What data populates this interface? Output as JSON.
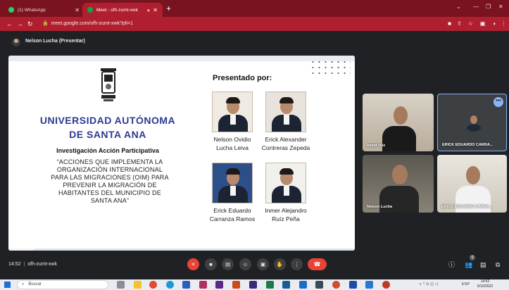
{
  "browser": {
    "tabs": [
      {
        "title": "(1) WhatsApp",
        "favicon_color": "#25d366",
        "active": false
      },
      {
        "title": "Meet - ofh-zumt-xwk",
        "favicon_color": "#00ac47",
        "active": true
      }
    ],
    "url": "meet.google.com/ofh-zumt-xwk?pli=1",
    "tab_color": "#7a1320",
    "toolbar_color": "#b01f2f"
  },
  "meet": {
    "presenter_label": "Nelson Lucha (Presentar)",
    "time": "14:52",
    "meeting_code": "ofh-zumt-xwk",
    "participant_count": "6",
    "participants": [
      {
        "name": "Inmer ruiz"
      },
      {
        "name": "ERICK EDUARDO CARRA..."
      },
      {
        "name": "Nelson Lucha"
      },
      {
        "name": "ERICK EDUARDO CARRA..."
      }
    ]
  },
  "slide": {
    "university": "UNIVERSIDAD AUTÓNOMA DE SANTA ANA",
    "university_line1": "UNIVERSIDAD AUTÓNOMA",
    "university_line2": "DE SANTA ANA",
    "research_type": "Investigación Acción Participativa",
    "quote_lines": [
      "“ACCIONES QUE IMPLEMENTA LA",
      "ORGANIZACIÓN INTERNACIONAL",
      "PARA LAS MIGRACIONES (OIM) PARA",
      "PREVENIR LA MIGRACIÓN DE",
      "HABITANTES DEL MUNICIPIO DE",
      "SANTA ANA”"
    ],
    "presented_by": "Presentado por:",
    "presenters": [
      {
        "line1": "Nelson Ovidio",
        "line2": "Lucha Leiva"
      },
      {
        "line1": "Erick Alexander",
        "line2": "Contreras Zepeda"
      },
      {
        "line1": "Erick Eduardo",
        "line2": "Carranza Ramos"
      },
      {
        "line1": "Inmer Alejandro",
        "line2": "Ruíz Peña"
      }
    ],
    "title_color": "#2b3a8f"
  },
  "taskbar": {
    "search_placeholder": "Buscar",
    "language": "ESP",
    "time": "14:52",
    "date": "6/10/2023"
  }
}
